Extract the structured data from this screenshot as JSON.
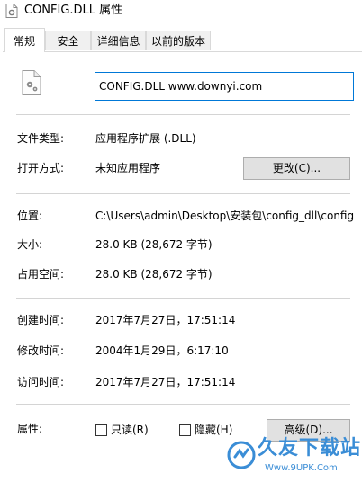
{
  "window": {
    "title": "CONFIG.DLL 属性"
  },
  "tabs": [
    {
      "label": "常规",
      "active": true
    },
    {
      "label": "安全",
      "active": false
    },
    {
      "label": "详细信息",
      "active": false
    },
    {
      "label": "以前的版本",
      "active": false
    }
  ],
  "general": {
    "file_name": "CONFIG.DLL www.downyi.com",
    "file_type_label": "文件类型:",
    "file_type_value": "应用程序扩展 (.DLL)",
    "opens_with_label": "打开方式:",
    "opens_with_value": "未知应用程序",
    "change_button": "更改(C)...",
    "location_label": "位置:",
    "location_value": "C:\\Users\\admin\\Desktop\\安装包\\config_dll\\config",
    "size_label": "大小:",
    "size_value": "28.0 KB (28,672 字节)",
    "size_on_disk_label": "占用空间:",
    "size_on_disk_value": "28.0 KB (28,672 字节)",
    "created_label": "创建时间:",
    "created_value": "2017年7月27日，17:51:14",
    "modified_label": "修改时间:",
    "modified_value": "2004年1月29日，6:17:10",
    "accessed_label": "访问时间:",
    "accessed_value": "2017年7月27日，17:51:14",
    "attributes_label": "属性:",
    "readonly_label": "只读(R)",
    "hidden_label": "隐藏(H)",
    "advanced_button": "高级(D)..."
  },
  "watermark": {
    "title": "久友下载站",
    "url": "Www.9UPK.Com"
  },
  "colors": {
    "accent": "#0078d7",
    "watermark": "#3a8dd6"
  }
}
